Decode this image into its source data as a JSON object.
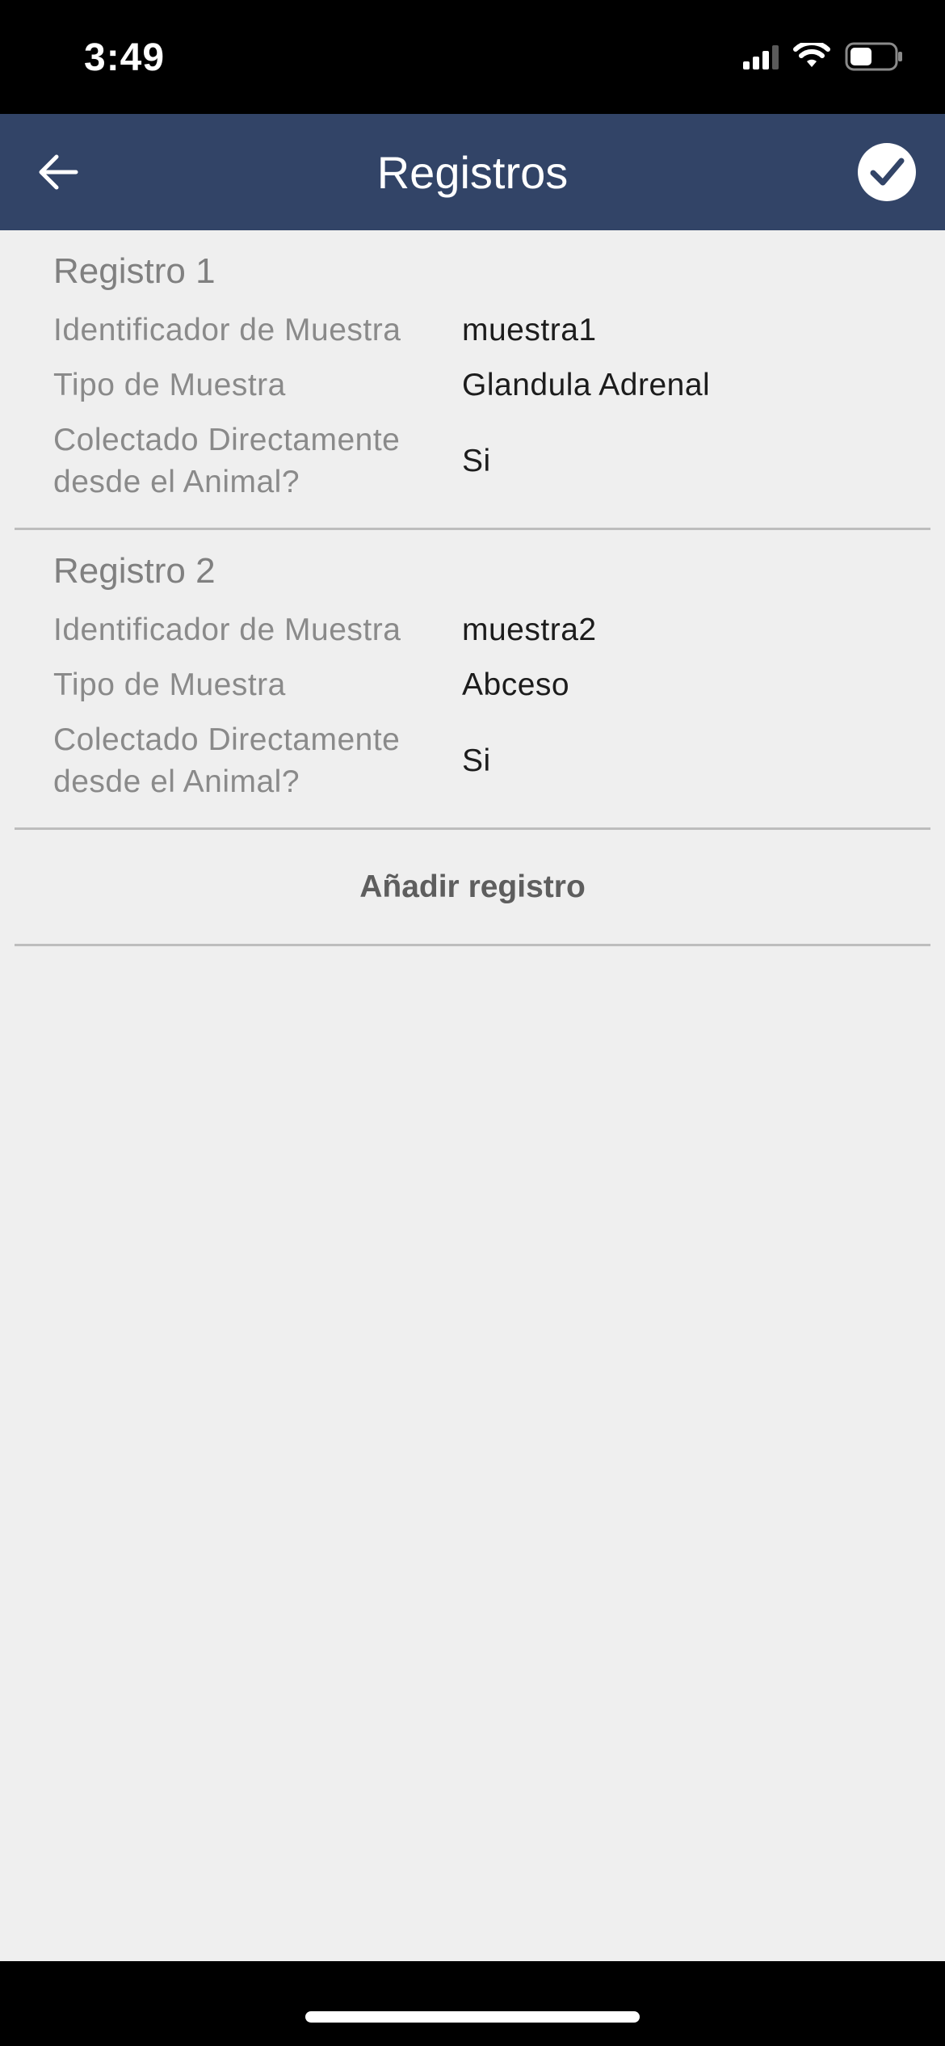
{
  "status_bar": {
    "time": "3:49",
    "icons": [
      "cellular-signal-icon",
      "wifi-icon",
      "battery-icon"
    ],
    "battery_level": 0.5
  },
  "nav": {
    "title": "Registros",
    "back_icon": "arrow-left-icon",
    "confirm_icon": "checkmark-circle-icon"
  },
  "records": [
    {
      "title": "Registro 1",
      "fields": [
        {
          "label": "Identificador de Muestra",
          "value": "muestra1"
        },
        {
          "label": "Tipo de Muestra",
          "value": "Glandula Adrenal"
        },
        {
          "label": "Colectado Directamente desde el Animal?",
          "value": "Si"
        }
      ]
    },
    {
      "title": "Registro 2",
      "fields": [
        {
          "label": "Identificador de Muestra",
          "value": "muestra2"
        },
        {
          "label": "Tipo de Muestra",
          "value": "Abceso"
        },
        {
          "label": "Colectado Directamente desde el Animal?",
          "value": "Si"
        }
      ]
    }
  ],
  "add_record_label": "Añadir registro",
  "colors": {
    "nav_background": "#324467",
    "content_background": "#efefef",
    "divider": "#bdbdbd"
  }
}
